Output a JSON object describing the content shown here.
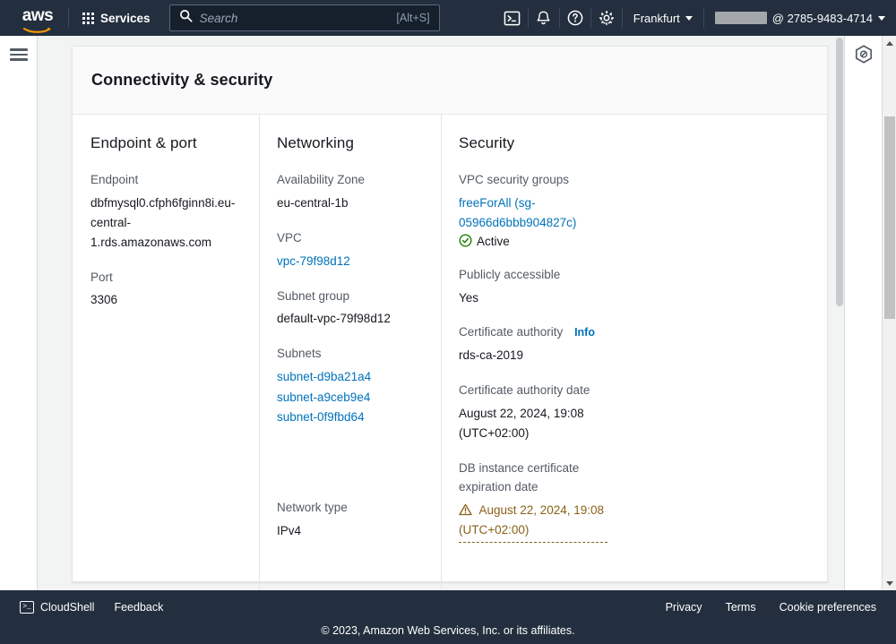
{
  "topnav": {
    "logo_text": "aws",
    "services_label": "Services",
    "search_placeholder": "Search",
    "search_value": "",
    "search_shortcut": "[Alt+S]",
    "cloudshell_icon": "terminal-icon",
    "notifications_icon": "bell-icon",
    "help_icon": "question-circle-icon",
    "settings_icon": "gear-icon",
    "region": "Frankfurt",
    "account_id": "@ 2785-9483-4714",
    "account_name_redacted": true
  },
  "rails": {
    "menu_icon": "hamburger-menu-icon",
    "right_tool_icon": "hexagon-shield-icon"
  },
  "panel": {
    "title": "Connectivity & security",
    "columns": {
      "endpoint": {
        "title": "Endpoint & port",
        "fields": [
          {
            "label": "Endpoint",
            "value": "dbfmysql0.cfph6fginn8i.eu-central-1.rds.amazonaws.com"
          },
          {
            "label": "Port",
            "value": "3306"
          }
        ]
      },
      "networking": {
        "title": "Networking",
        "fields": [
          {
            "label": "Availability Zone",
            "value": "eu-central-1b"
          },
          {
            "label": "VPC",
            "value": "vpc-79f98d12",
            "is_link": true
          },
          {
            "label": "Subnet group",
            "value": "default-vpc-79f98d12"
          }
        ],
        "subnets_label": "Subnets",
        "subnets": [
          "subnet-d9ba21a4",
          "subnet-a9ceb9e4",
          "subnet-0f9fbd64"
        ],
        "network_type_label": "Network type",
        "network_type_value": "IPv4"
      },
      "security": {
        "title": "Security",
        "sg_label": "VPC security groups",
        "sg_link": "freeForAll (sg-05966d6bbb904827c)",
        "sg_status": "Active",
        "sg_status_icon": "check-circle-icon",
        "publicly_accessible_label": "Publicly accessible",
        "publicly_accessible_value": "Yes",
        "ca_label": "Certificate authority",
        "ca_info_link": "Info",
        "ca_value": "rds-ca-2019",
        "ca_date_label": "Certificate authority date",
        "ca_date_value": "August 22, 2024, 19:08 (UTC+02:00)",
        "cert_exp_label": "DB instance certificate expiration date",
        "cert_exp_value": "August 22, 2024, 19:08 (UTC+02:00)",
        "cert_exp_icon": "warning-triangle-icon"
      }
    }
  },
  "footer": {
    "cloudshell": "CloudShell",
    "feedback": "Feedback",
    "privacy": "Privacy",
    "terms": "Terms",
    "cookie_preferences": "Cookie preferences",
    "copyright": "© 2023, Amazon Web Services, Inc. or its affiliates."
  },
  "colors": {
    "nav_bg": "#232f3e",
    "link": "#0073bb",
    "success": "#1d8102",
    "warning": "#8a6116",
    "page_bg": "#f2f3f3"
  }
}
